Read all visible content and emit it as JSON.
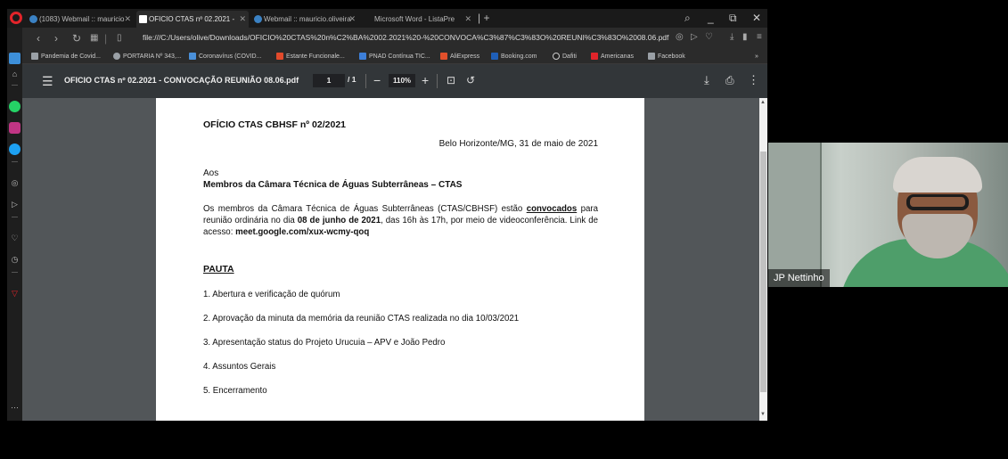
{
  "tabs": [
    {
      "label": "(1083) Webmail :: mauricio",
      "color": "#3b82c4",
      "active": false
    },
    {
      "label": "OFICIO CTAS nº 02.2021 - ",
      "color": "#ffffff",
      "active": true
    },
    {
      "label": "Webmail :: mauricio.oliveira",
      "color": "#3b82c4",
      "active": false
    },
    {
      "label": "Microsoft Word - ListaPre",
      "color": "#2b579a",
      "active": false
    }
  ],
  "window_controls": {
    "search": "⌕",
    "minimize": "_",
    "restore": "⧉",
    "close": "✕"
  },
  "address": {
    "url": "file:///C:/Users/olive/Downloads/OFICIO%20CTAS%20n%C2%BA%2002.2021%20-%20CONVOCA%C3%87%C3%83O%20REUNI%C3%83O%2008.06.pdf"
  },
  "bookmarks": [
    {
      "label": "Pandemia de Covid...",
      "color": "#9aa0a6"
    },
    {
      "label": "PORTARIA Nº 343,...",
      "color": "#9aa0a6"
    },
    {
      "label": "Coronavírus (COVID...",
      "color": "#4a90d9"
    },
    {
      "label": "Estante Funcionale...",
      "color": "#e24a2b"
    },
    {
      "label": "PNAD Contínua TIC...",
      "color": "#3d7fd9"
    },
    {
      "label": "AliExpress",
      "color": "#e2502b"
    },
    {
      "label": "Booking.com",
      "color": "#1f5fb8"
    },
    {
      "label": "Dafiti",
      "color": "#222222"
    },
    {
      "label": "Americanas",
      "color": "#e0242a"
    },
    {
      "label": "Facebook",
      "color": "#9aa0a6"
    }
  ],
  "pdf_toolbar": {
    "title": "OFICIO CTAS nº 02.2021 - CONVOCAÇÃO REUNIÃO 08.06.pdf",
    "page_current": "1",
    "page_total": "/ 1",
    "zoom": "110%"
  },
  "document": {
    "heading": "OFÍCIO CTAS CBHSF nº 02/2021",
    "date_line": "Belo Horizonte/MG, 31 de maio de 2021",
    "aos": "Aos",
    "recipients": "Membros da Câmara Técnica de Águas Subterrâneas – CTAS",
    "body_part1": "Os membros da Câmara Técnica de Águas Subterrâneas (CTAS/CBHSF) estão ",
    "body_convocados": "convocados",
    "body_part2": " para reunião ordinária no dia ",
    "body_date": "08 de junho de 2021",
    "body_part3": ", das 16h às 17h, por meio de videoconferência. Link de acesso: ",
    "body_link": "meet.google.com/xux-wcmy-qoq",
    "pauta_title": "PAUTA",
    "pauta_items": [
      "1. Abertura e verificação de quórum",
      "2. Aprovação da minuta da memória da reunião CTAS realizada no dia 10/03/2021",
      "3. Apresentação status do Projeto Urucuia – APV e João Pedro",
      "4. Assuntos Gerais",
      "5. Encerramento"
    ]
  },
  "participant": {
    "name": "JP Nettinho"
  },
  "colors": {
    "accent_red": "#e2242a",
    "toolbar": "#323639",
    "viewer_bg": "#525659"
  }
}
